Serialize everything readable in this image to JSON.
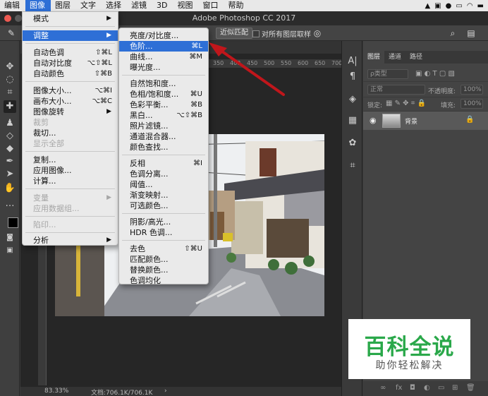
{
  "menubar": {
    "items": [
      "编辑",
      "图像",
      "图层",
      "文字",
      "选择",
      "滤镜",
      "3D",
      "视图",
      "窗口",
      "帮助"
    ],
    "active": "图像"
  },
  "titlebar": {
    "title": "Adobe Photoshop CC 2017"
  },
  "optbar": {
    "match_label": "近似匹配",
    "sample_all_label": "对所有图层取样"
  },
  "image_menu": {
    "items": [
      {
        "label": "模式",
        "submenu": true
      },
      {
        "label": "调整",
        "submenu": true,
        "highlighted": true
      },
      {
        "label": "自动色调",
        "shortcut": "⇧⌘L"
      },
      {
        "label": "自动对比度",
        "shortcut": "⌥⇧⌘L"
      },
      {
        "label": "自动颜色",
        "shortcut": "⇧⌘B"
      },
      {
        "label": "图像大小...",
        "shortcut": "⌥⌘I"
      },
      {
        "label": "画布大小...",
        "shortcut": "⌥⌘C"
      },
      {
        "label": "图像旋转",
        "submenu": true
      },
      {
        "label": "裁剪",
        "disabled": true
      },
      {
        "label": "裁切..."
      },
      {
        "label": "显示全部",
        "disabled": true
      },
      {
        "label": "复制..."
      },
      {
        "label": "应用图像..."
      },
      {
        "label": "计算..."
      },
      {
        "label": "变量",
        "submenu": true,
        "disabled": true
      },
      {
        "label": "应用数据组...",
        "disabled": true
      },
      {
        "label": "陷印...",
        "disabled": true
      },
      {
        "label": "分析",
        "submenu": true
      }
    ]
  },
  "adjust_submenu": {
    "items": [
      {
        "label": "亮度/对比度..."
      },
      {
        "label": "色阶...",
        "shortcut": "⌘L",
        "highlighted": true
      },
      {
        "label": "曲线...",
        "shortcut": "⌘M"
      },
      {
        "label": "曝光度..."
      },
      {
        "label": "自然饱和度..."
      },
      {
        "label": "色相/饱和度...",
        "shortcut": "⌘U"
      },
      {
        "label": "色彩平衡...",
        "shortcut": "⌘B"
      },
      {
        "label": "黑白...",
        "shortcut": "⌥⇧⌘B"
      },
      {
        "label": "照片滤镜..."
      },
      {
        "label": "通道混合器..."
      },
      {
        "label": "颜色查找..."
      },
      {
        "label": "反相",
        "shortcut": "⌘I"
      },
      {
        "label": "色调分离..."
      },
      {
        "label": "阈值..."
      },
      {
        "label": "渐变映射..."
      },
      {
        "label": "可选颜色..."
      },
      {
        "label": "阴影/高光..."
      },
      {
        "label": "HDR 色调..."
      },
      {
        "label": "去色",
        "shortcut": "⇧⌘U"
      },
      {
        "label": "匹配颜色..."
      },
      {
        "label": "替换颜色..."
      },
      {
        "label": "色调均化"
      }
    ]
  },
  "ruler": {
    "ticks": [
      "350",
      "400",
      "450",
      "500",
      "550",
      "600",
      "650",
      "700",
      "750"
    ]
  },
  "status": {
    "zoom": "83.33%",
    "doc": "文档:706.1K/706.1K"
  },
  "layers_panel": {
    "tabs": [
      "图层",
      "通道",
      "路径"
    ],
    "kind_label": "ρ类型",
    "blend_mode": "正常",
    "opacity_label": "不透明度:",
    "opacity_value": "100%",
    "lock_label": "锁定:",
    "fill_label": "填充:",
    "fill_value": "100%",
    "layer_name": "背景"
  },
  "watermark": {
    "main": "百科全说",
    "sub": "助你轻松解决"
  },
  "colors": {
    "highlight": "#2e6fd6",
    "arrow": "#c0161b",
    "watermark_green": "#2aa84a"
  }
}
